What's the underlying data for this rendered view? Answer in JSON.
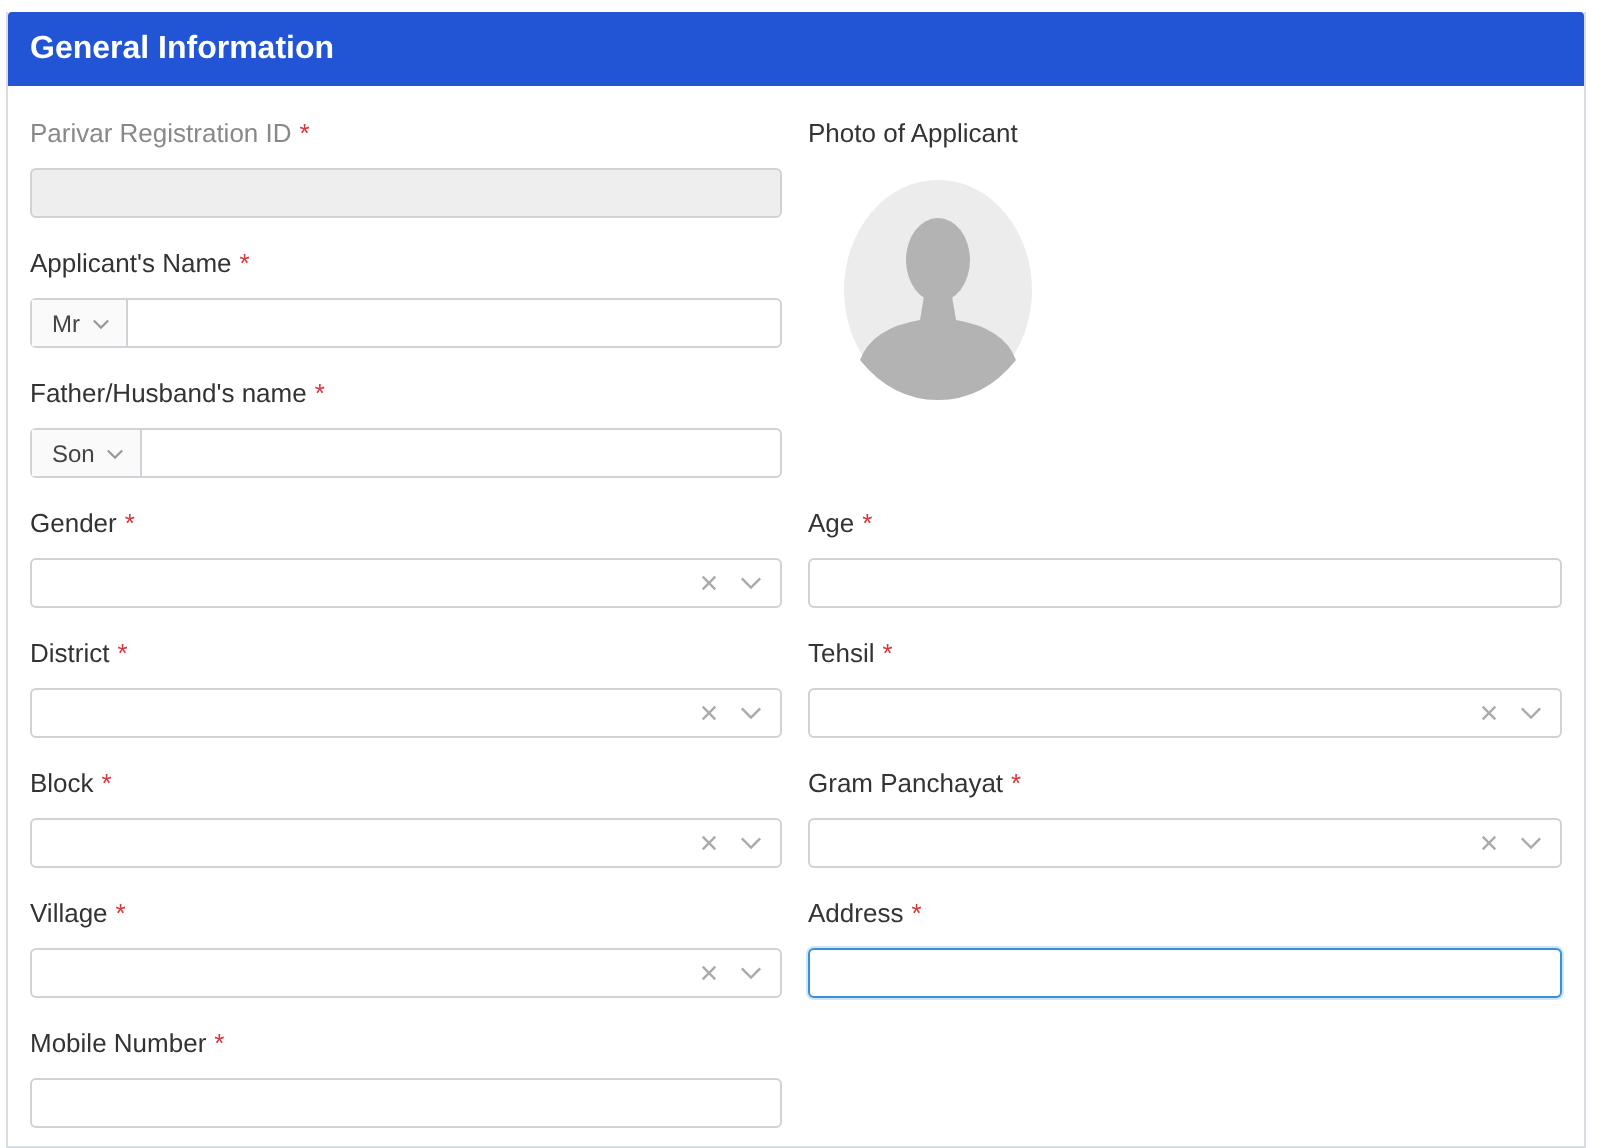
{
  "panel": {
    "title": "General Information"
  },
  "fields": [
    {
      "kind": "disabled",
      "label": "Parivar Registration ID",
      "required_mark": "*"
    },
    {
      "kind": "photo",
      "label": "Photo of Applicant"
    },
    {
      "kind": "prefixed",
      "label": "Applicant's Name",
      "required_mark": "*",
      "prefix": "Mr"
    },
    {
      "kind": "prefixed",
      "label": "Father/Husband's name",
      "required_mark": "*",
      "prefix": "Son"
    },
    {
      "kind": "select",
      "label": "Gender",
      "required_mark": "*"
    },
    {
      "kind": "text",
      "label": "Age",
      "required_mark": "*",
      "focused": false
    },
    {
      "kind": "select",
      "label": "District",
      "required_mark": "*"
    },
    {
      "kind": "select",
      "label": "Tehsil",
      "required_mark": "*"
    },
    {
      "kind": "select",
      "label": "Block",
      "required_mark": "*"
    },
    {
      "kind": "select",
      "label": "Gram Panchayat",
      "required_mark": "*"
    },
    {
      "kind": "select",
      "label": "Village",
      "required_mark": "*"
    },
    {
      "kind": "text",
      "label": "Address",
      "required_mark": "*",
      "focused": true
    },
    {
      "kind": "text",
      "label": "Mobile Number",
      "required_mark": "*",
      "focused": false
    }
  ]
}
